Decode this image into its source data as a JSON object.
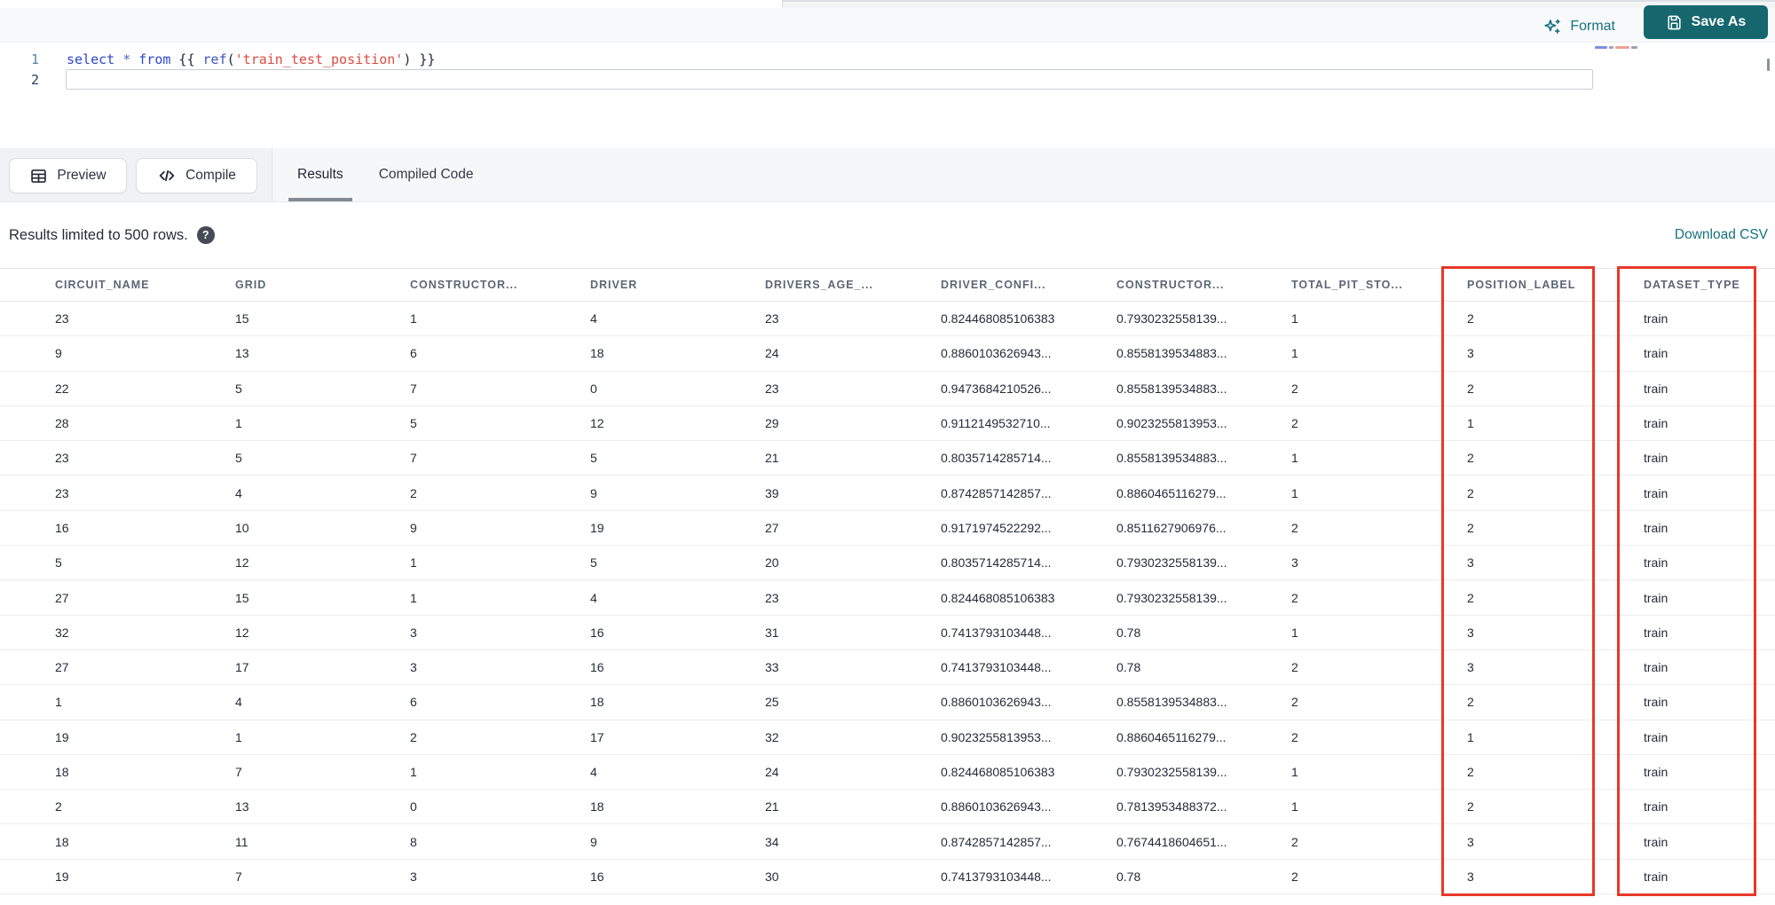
{
  "top_bar": {
    "format_label": "Format",
    "save_as_label": "Save As"
  },
  "editor": {
    "line_numbers": [
      "1",
      "2"
    ],
    "code_tokens": [
      {
        "text": "select",
        "type": "keyword"
      },
      {
        "text": " ",
        "type": "plain"
      },
      {
        "text": "*",
        "type": "operator"
      },
      {
        "text": " ",
        "type": "plain"
      },
      {
        "text": "from",
        "type": "keyword"
      },
      {
        "text": " {{ ",
        "type": "plain"
      },
      {
        "text": "ref",
        "type": "function"
      },
      {
        "text": "(",
        "type": "plain"
      },
      {
        "text": "'train_test_position'",
        "type": "string"
      },
      {
        "text": ")",
        "type": "plain"
      },
      {
        "text": " }}",
        "type": "plain"
      }
    ]
  },
  "actions": {
    "preview_label": "Preview",
    "compile_label": "Compile"
  },
  "tabs": [
    {
      "label": "Results",
      "active": true
    },
    {
      "label": "Compiled Code",
      "active": false
    }
  ],
  "results_bar": {
    "message": "Results limited to 500 rows.",
    "help_glyph": "?",
    "download_label": "Download CSV"
  },
  "table": {
    "columns": [
      "CIRCUIT_NAME",
      "GRID",
      "CONSTRUCTOR...",
      "DRIVER",
      "DRIVERS_AGE_...",
      "DRIVER_CONFI...",
      "CONSTRUCTOR...",
      "TOTAL_PIT_STO...",
      "POSITION_LABEL",
      "DATASET_TYPE"
    ],
    "rows": [
      [
        "23",
        "15",
        "1",
        "4",
        "23",
        "0.824468085106383",
        "0.7930232558139...",
        "1",
        "2",
        "train"
      ],
      [
        "9",
        "13",
        "6",
        "18",
        "24",
        "0.8860103626943...",
        "0.8558139534883...",
        "1",
        "3",
        "train"
      ],
      [
        "22",
        "5",
        "7",
        "0",
        "23",
        "0.9473684210526...",
        "0.8558139534883...",
        "2",
        "2",
        "train"
      ],
      [
        "28",
        "1",
        "5",
        "12",
        "29",
        "0.9112149532710...",
        "0.9023255813953...",
        "2",
        "1",
        "train"
      ],
      [
        "23",
        "5",
        "7",
        "5",
        "21",
        "0.8035714285714...",
        "0.8558139534883...",
        "1",
        "2",
        "train"
      ],
      [
        "23",
        "4",
        "2",
        "9",
        "39",
        "0.8742857142857...",
        "0.8860465116279...",
        "1",
        "2",
        "train"
      ],
      [
        "16",
        "10",
        "9",
        "19",
        "27",
        "0.9171974522292...",
        "0.8511627906976...",
        "2",
        "2",
        "train"
      ],
      [
        "5",
        "12",
        "1",
        "5",
        "20",
        "0.8035714285714...",
        "0.7930232558139...",
        "3",
        "3",
        "train"
      ],
      [
        "27",
        "15",
        "1",
        "4",
        "23",
        "0.824468085106383",
        "0.7930232558139...",
        "2",
        "2",
        "train"
      ],
      [
        "32",
        "12",
        "3",
        "16",
        "31",
        "0.7413793103448...",
        "0.78",
        "1",
        "3",
        "train"
      ],
      [
        "27",
        "17",
        "3",
        "16",
        "33",
        "0.7413793103448...",
        "0.78",
        "2",
        "3",
        "train"
      ],
      [
        "1",
        "4",
        "6",
        "18",
        "25",
        "0.8860103626943...",
        "0.8558139534883...",
        "2",
        "2",
        "train"
      ],
      [
        "19",
        "1",
        "2",
        "17",
        "32",
        "0.9023255813953...",
        "0.8860465116279...",
        "2",
        "1",
        "train"
      ],
      [
        "18",
        "7",
        "1",
        "4",
        "24",
        "0.824468085106383",
        "0.7930232558139...",
        "1",
        "2",
        "train"
      ],
      [
        "2",
        "13",
        "0",
        "18",
        "21",
        "0.8860103626943...",
        "0.7813953488372...",
        "1",
        "2",
        "train"
      ],
      [
        "18",
        "11",
        "8",
        "9",
        "34",
        "0.8742857142857...",
        "0.7674418604651...",
        "2",
        "3",
        "train"
      ],
      [
        "19",
        "7",
        "3",
        "16",
        "30",
        "0.7413793103448...",
        "0.78",
        "2",
        "3",
        "train"
      ]
    ],
    "highlighted_columns": [
      "POSITION_LABEL",
      "DATASET_TYPE"
    ]
  },
  "colors": {
    "accent_teal": "#15666d",
    "link_teal": "#16717e",
    "highlight_red": "#e8382a"
  }
}
